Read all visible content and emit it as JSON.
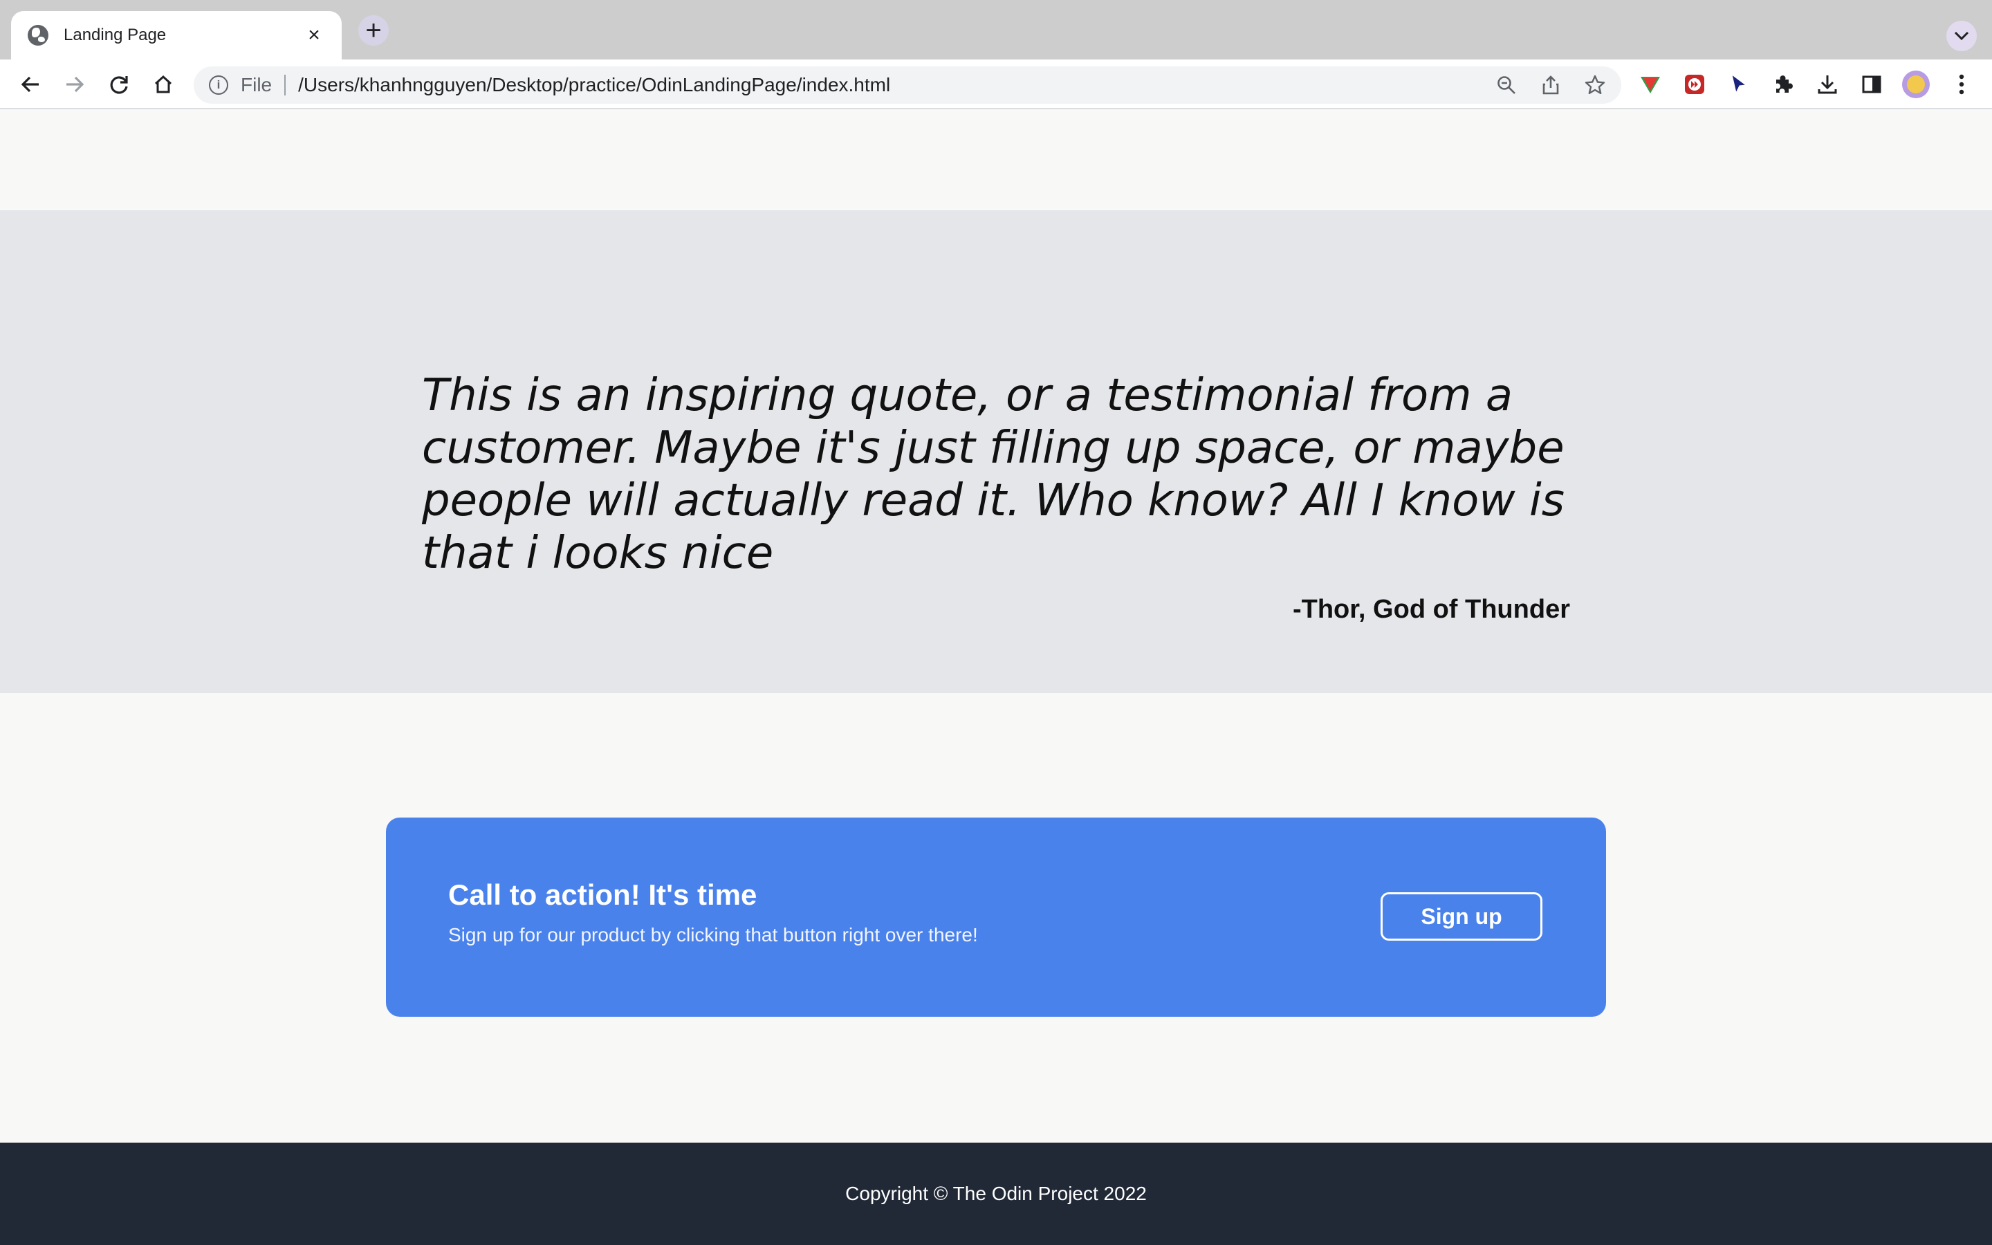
{
  "browser": {
    "tab": {
      "title": "Landing Page",
      "favicon": "globe-icon"
    },
    "new_tab_label": "+",
    "address": {
      "scheme": "File",
      "url": "/Users/khanhngguyen/Desktop/practice/OdinLandingPage/index.html"
    },
    "icons": [
      "back-arrow-icon",
      "forward-arrow-icon",
      "reload-icon",
      "home-icon",
      "info-icon",
      "zoom-out-icon",
      "share-icon",
      "bookmark-star-icon",
      "watermelon-extension-icon",
      "red-extension-icon",
      "cursor-extension-icon",
      "puzzle-extensions-icon",
      "download-icon",
      "side-panel-icon",
      "profile-avatar-icon",
      "kebab-menu-icon"
    ]
  },
  "quote": {
    "text": "This is an inspiring quote, or a testimonial from a customer. Maybe it's just filling up space, or maybe people will actually read it. Who know? All I know is that i looks nice",
    "author": "-Thor, God of Thunder"
  },
  "cta": {
    "title": "Call to action! It's time",
    "subtitle": "Sign up for our product by clicking that button right over there!",
    "button_label": "Sign up"
  },
  "footer": {
    "copyright": "Copyright © The Odin Project 2022"
  },
  "colors": {
    "page_bg": "#f8f8f6",
    "quote_bg": "#e5e6ea",
    "cta_bg": "#4a82ec",
    "footer_bg": "#212836"
  }
}
